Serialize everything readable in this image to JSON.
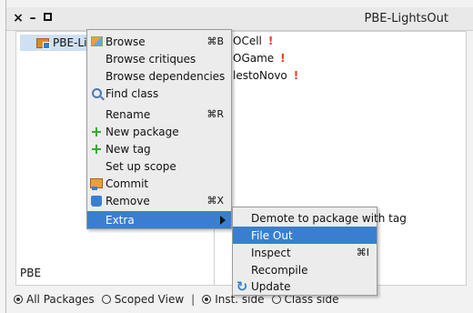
{
  "window": {
    "title": "PBE-LightsOut",
    "close_label": "×",
    "minimize_label": "–"
  },
  "packages_pane": {
    "selected_package": "PBE-Lig",
    "footer_label": "PBE"
  },
  "classes_pane": {
    "items": [
      {
        "label": "OCell",
        "flag": "!"
      },
      {
        "label": "OGame",
        "flag": "!"
      },
      {
        "label": "lestoNovo",
        "flag": "!"
      }
    ]
  },
  "context_menu": {
    "items": [
      {
        "label": "Browse",
        "shortcut": "⌘B",
        "icon": "browse-icon"
      },
      {
        "label": "Browse critiques",
        "shortcut": "",
        "icon": ""
      },
      {
        "label": "Browse dependencies",
        "shortcut": "",
        "icon": ""
      },
      {
        "label": "Find class",
        "shortcut": "",
        "icon": "find-icon"
      },
      {
        "label": "Rename",
        "shortcut": "⌘R",
        "icon": ""
      },
      {
        "label": "New package",
        "shortcut": "",
        "icon": "plus-icon"
      },
      {
        "label": "New tag",
        "shortcut": "",
        "icon": "plus-icon"
      },
      {
        "label": "Set up scope",
        "shortcut": "",
        "icon": ""
      },
      {
        "label": "Commit",
        "shortcut": "",
        "icon": "commit-icon"
      },
      {
        "label": "Remove",
        "shortcut": "⌘X",
        "icon": "trash-icon"
      },
      {
        "label": "Extra",
        "shortcut": "",
        "icon": "",
        "submenu": true
      }
    ]
  },
  "extra_submenu": {
    "items": [
      {
        "label": "Demote to package with tag",
        "shortcut": "",
        "icon": ""
      },
      {
        "label": "File Out",
        "shortcut": "",
        "icon": "",
        "selected": true
      },
      {
        "label": "Inspect",
        "shortcut": "⌘I",
        "icon": ""
      },
      {
        "label": "Recompile",
        "shortcut": "",
        "icon": ""
      },
      {
        "label": "Update",
        "shortcut": "",
        "icon": "update-icon"
      }
    ]
  },
  "bottom_bar": {
    "all_packages": "All Packages",
    "scoped_view": "Scoped View",
    "separator": "|",
    "inst_side": "Inst. side",
    "class_side": "Class side"
  },
  "colors": {
    "highlight": "#3a7fcf",
    "warning": "#e53b1f"
  }
}
